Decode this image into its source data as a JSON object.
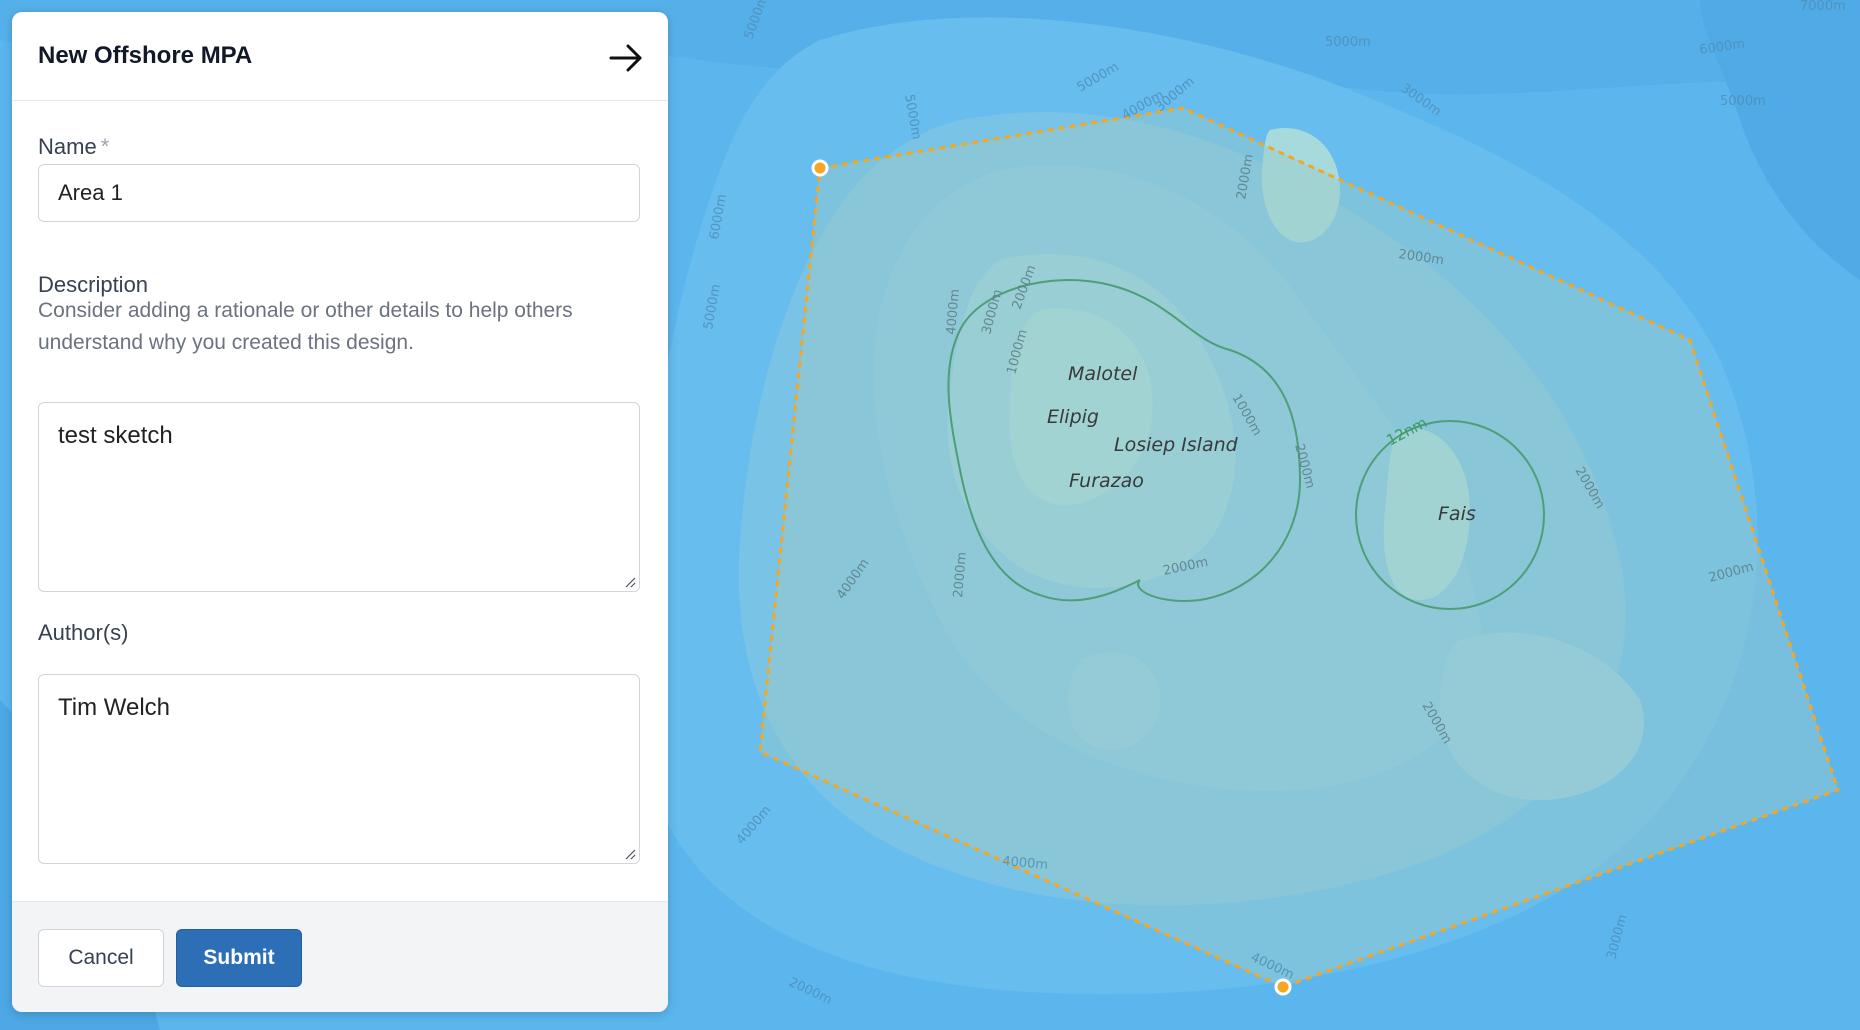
{
  "panel": {
    "title": "New Offshore MPA",
    "close_icon": "arrow-right-icon",
    "name_label": "Name",
    "name_required_mark": "*",
    "name_value": "Area 1",
    "description_label": "Description",
    "description_help": "Consider adding a rationale or other details to help others understand why you created this design.",
    "description_value": "test sketch",
    "authors_label": "Author(s)",
    "authors_value": "Tim Welch",
    "cancel_label": "Cancel",
    "submit_label": "Submit"
  },
  "map": {
    "islands": {
      "malotel": "Malotel",
      "elipig": "Elipig",
      "losiep": "Losiep Island",
      "furazao": "Furazao",
      "fais": "Fais"
    },
    "nm_label": "12nm",
    "depths": {
      "d1000": "1000m",
      "d2000": "2000m",
      "d3000": "3000m",
      "d4000": "4000m",
      "d5000": "5000m",
      "d6000": "6000m",
      "d7000": "7000m"
    },
    "colors": {
      "polygon_stroke": "#f5a623",
      "buffer_stroke": "#4e9e78"
    }
  }
}
